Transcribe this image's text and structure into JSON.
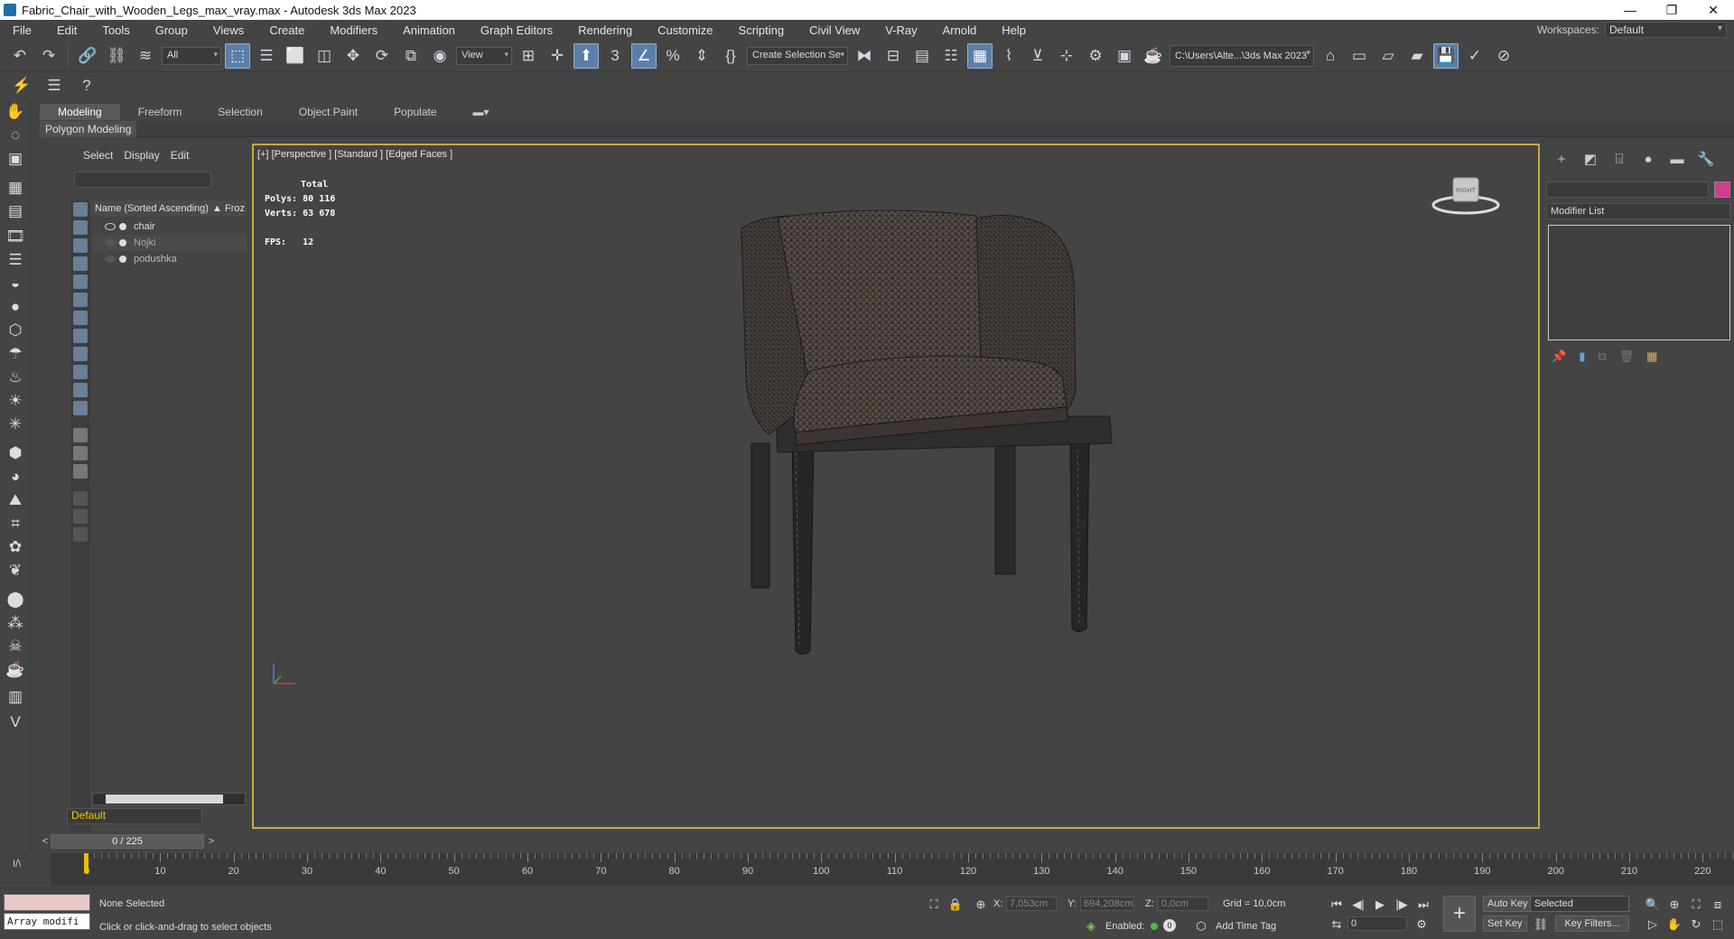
{
  "window": {
    "title": "Fabric_Chair_with_Wooden_Legs_max_vray.max - Autodesk 3ds Max 2023"
  },
  "menu": [
    "File",
    "Edit",
    "Tools",
    "Group",
    "Views",
    "Create",
    "Modifiers",
    "Animation",
    "Graph Editors",
    "Rendering",
    "Customize",
    "Scripting",
    "Civil View",
    "V-Ray",
    "Arnold",
    "Help"
  ],
  "workspaces": {
    "label": "Workspaces:",
    "value": "Default"
  },
  "toolbar": {
    "filter_value": "All",
    "refcoord_value": "View",
    "selection_set_placeholder": "Create Selection Se",
    "project_path": "C:\\Users\\Alte...\\3ds Max 2023"
  },
  "ribbon": {
    "tabs": [
      "Modeling",
      "Freeform",
      "Selection",
      "Object Paint",
      "Populate"
    ],
    "active": "Modeling",
    "panel": "Polygon Modeling"
  },
  "explorer": {
    "tabs": [
      "Select",
      "Display",
      "Edit"
    ],
    "column_header": "Name (Sorted Ascending)",
    "column_header2": "▲ Froz",
    "items": [
      {
        "name": "chair"
      },
      {
        "name": "Nojki"
      },
      {
        "name": "podushka"
      }
    ],
    "layer": "Default"
  },
  "viewport": {
    "label": "[+] [Perspective ] [Standard ] [Edged Faces ]",
    "stats_total": "Total",
    "polys_label": "Polys:",
    "polys_value": "80 116",
    "verts_label": "Verts:",
    "verts_value": "63 678",
    "fps_label": "FPS:",
    "fps_value": "12",
    "viewcube_label": "RIGHT"
  },
  "command_panel": {
    "modifier_list": "Modifier List",
    "object_color": "#d23c8f"
  },
  "timeslider": {
    "value": "0 / 225"
  },
  "trackbar": {
    "ticks": [
      "0",
      "10",
      "20",
      "30",
      "40",
      "50",
      "60",
      "70",
      "80",
      "90",
      "100",
      "110",
      "120",
      "130",
      "140",
      "150",
      "160",
      "170",
      "180",
      "190",
      "200",
      "210",
      "220"
    ]
  },
  "status": {
    "maxscript": "Array modifi",
    "selection": "None Selected",
    "prompt": "Click or click-and-drag to select objects",
    "x_label": "X:",
    "x_value": "7,053cm",
    "y_label": "Y:",
    "y_value": "694,208cm",
    "z_label": "Z:",
    "z_value": "0,0cm",
    "grid": "Grid = 10,0cm",
    "enabled_label": "Enabled:",
    "add_time_tag": "Add Time Tag",
    "frame_value": "0",
    "auto_key": "Auto Key",
    "set_key": "Set Key",
    "selected_dd": "Selected",
    "key_filters": "Key Filters..."
  }
}
